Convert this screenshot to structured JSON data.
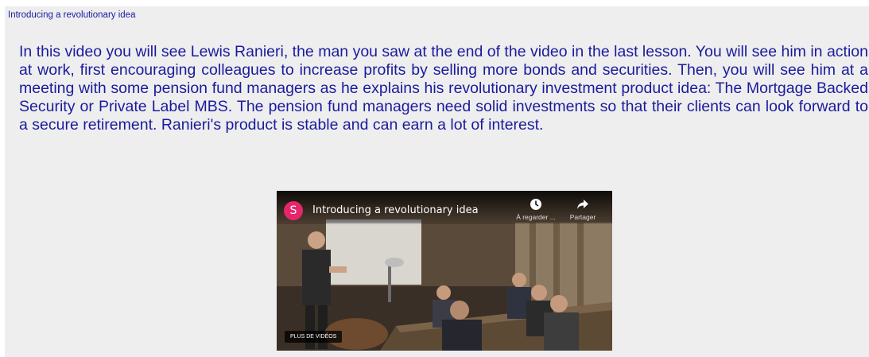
{
  "lesson": {
    "title": "Introducing a revolutionary idea",
    "intro_paragraph": "In this video you will see Lewis Ranieri, the man you saw at the end of the video in the last lesson. You will see him in action at work, first encouraging colleagues to increase profits by selling more bonds and securities. Then, you will see him at a meeting with some pension fund managers as he explains his revolutionary investment product idea: The Mortgage Backed Security or Private Label MBS. The pension fund managers need solid investments so that their clients can look forward to a secure retirement. Ranieri's product is stable and can earn a lot of interest."
  },
  "video": {
    "channel_initial": "S",
    "title": "Introducing a revolutionary idea",
    "watch_later_label": "À regarder ...",
    "share_label": "Partager",
    "more_videos_label": "PLUS DE VIDÉOS",
    "watch_later_icon": "clock-icon",
    "share_icon": "share-arrow-icon"
  },
  "colors": {
    "text_blue": "#1b1b9e",
    "panel_bg": "#eeeeee",
    "avatar_pink": "#e5266a"
  }
}
